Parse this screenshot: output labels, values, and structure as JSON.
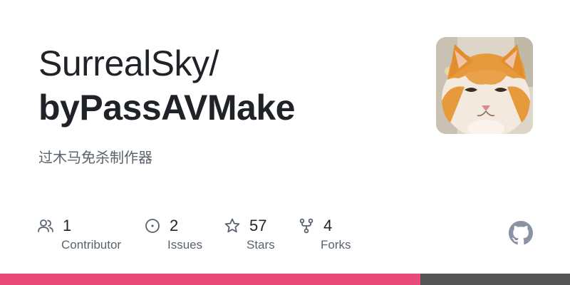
{
  "repo": {
    "owner": "SurrealSky/",
    "name": "byPassAVMake",
    "description": "过木马免杀制作器"
  },
  "stats": [
    {
      "icon": "people-icon",
      "value": "1",
      "label": "Contributor"
    },
    {
      "icon": "issue-icon",
      "value": "2",
      "label": "Issues"
    },
    {
      "icon": "star-icon",
      "value": "57",
      "label": "Stars"
    },
    {
      "icon": "fork-icon",
      "value": "4",
      "label": "Forks"
    }
  ],
  "avatar": {
    "icon": "cat-avatar"
  },
  "brand": {
    "icon": "github-icon",
    "color": "#8993a4"
  },
  "language_bar": [
    {
      "color": "#e84a7a",
      "fraction": 0.74
    },
    {
      "color": "#555555",
      "fraction": 0.26
    }
  ]
}
